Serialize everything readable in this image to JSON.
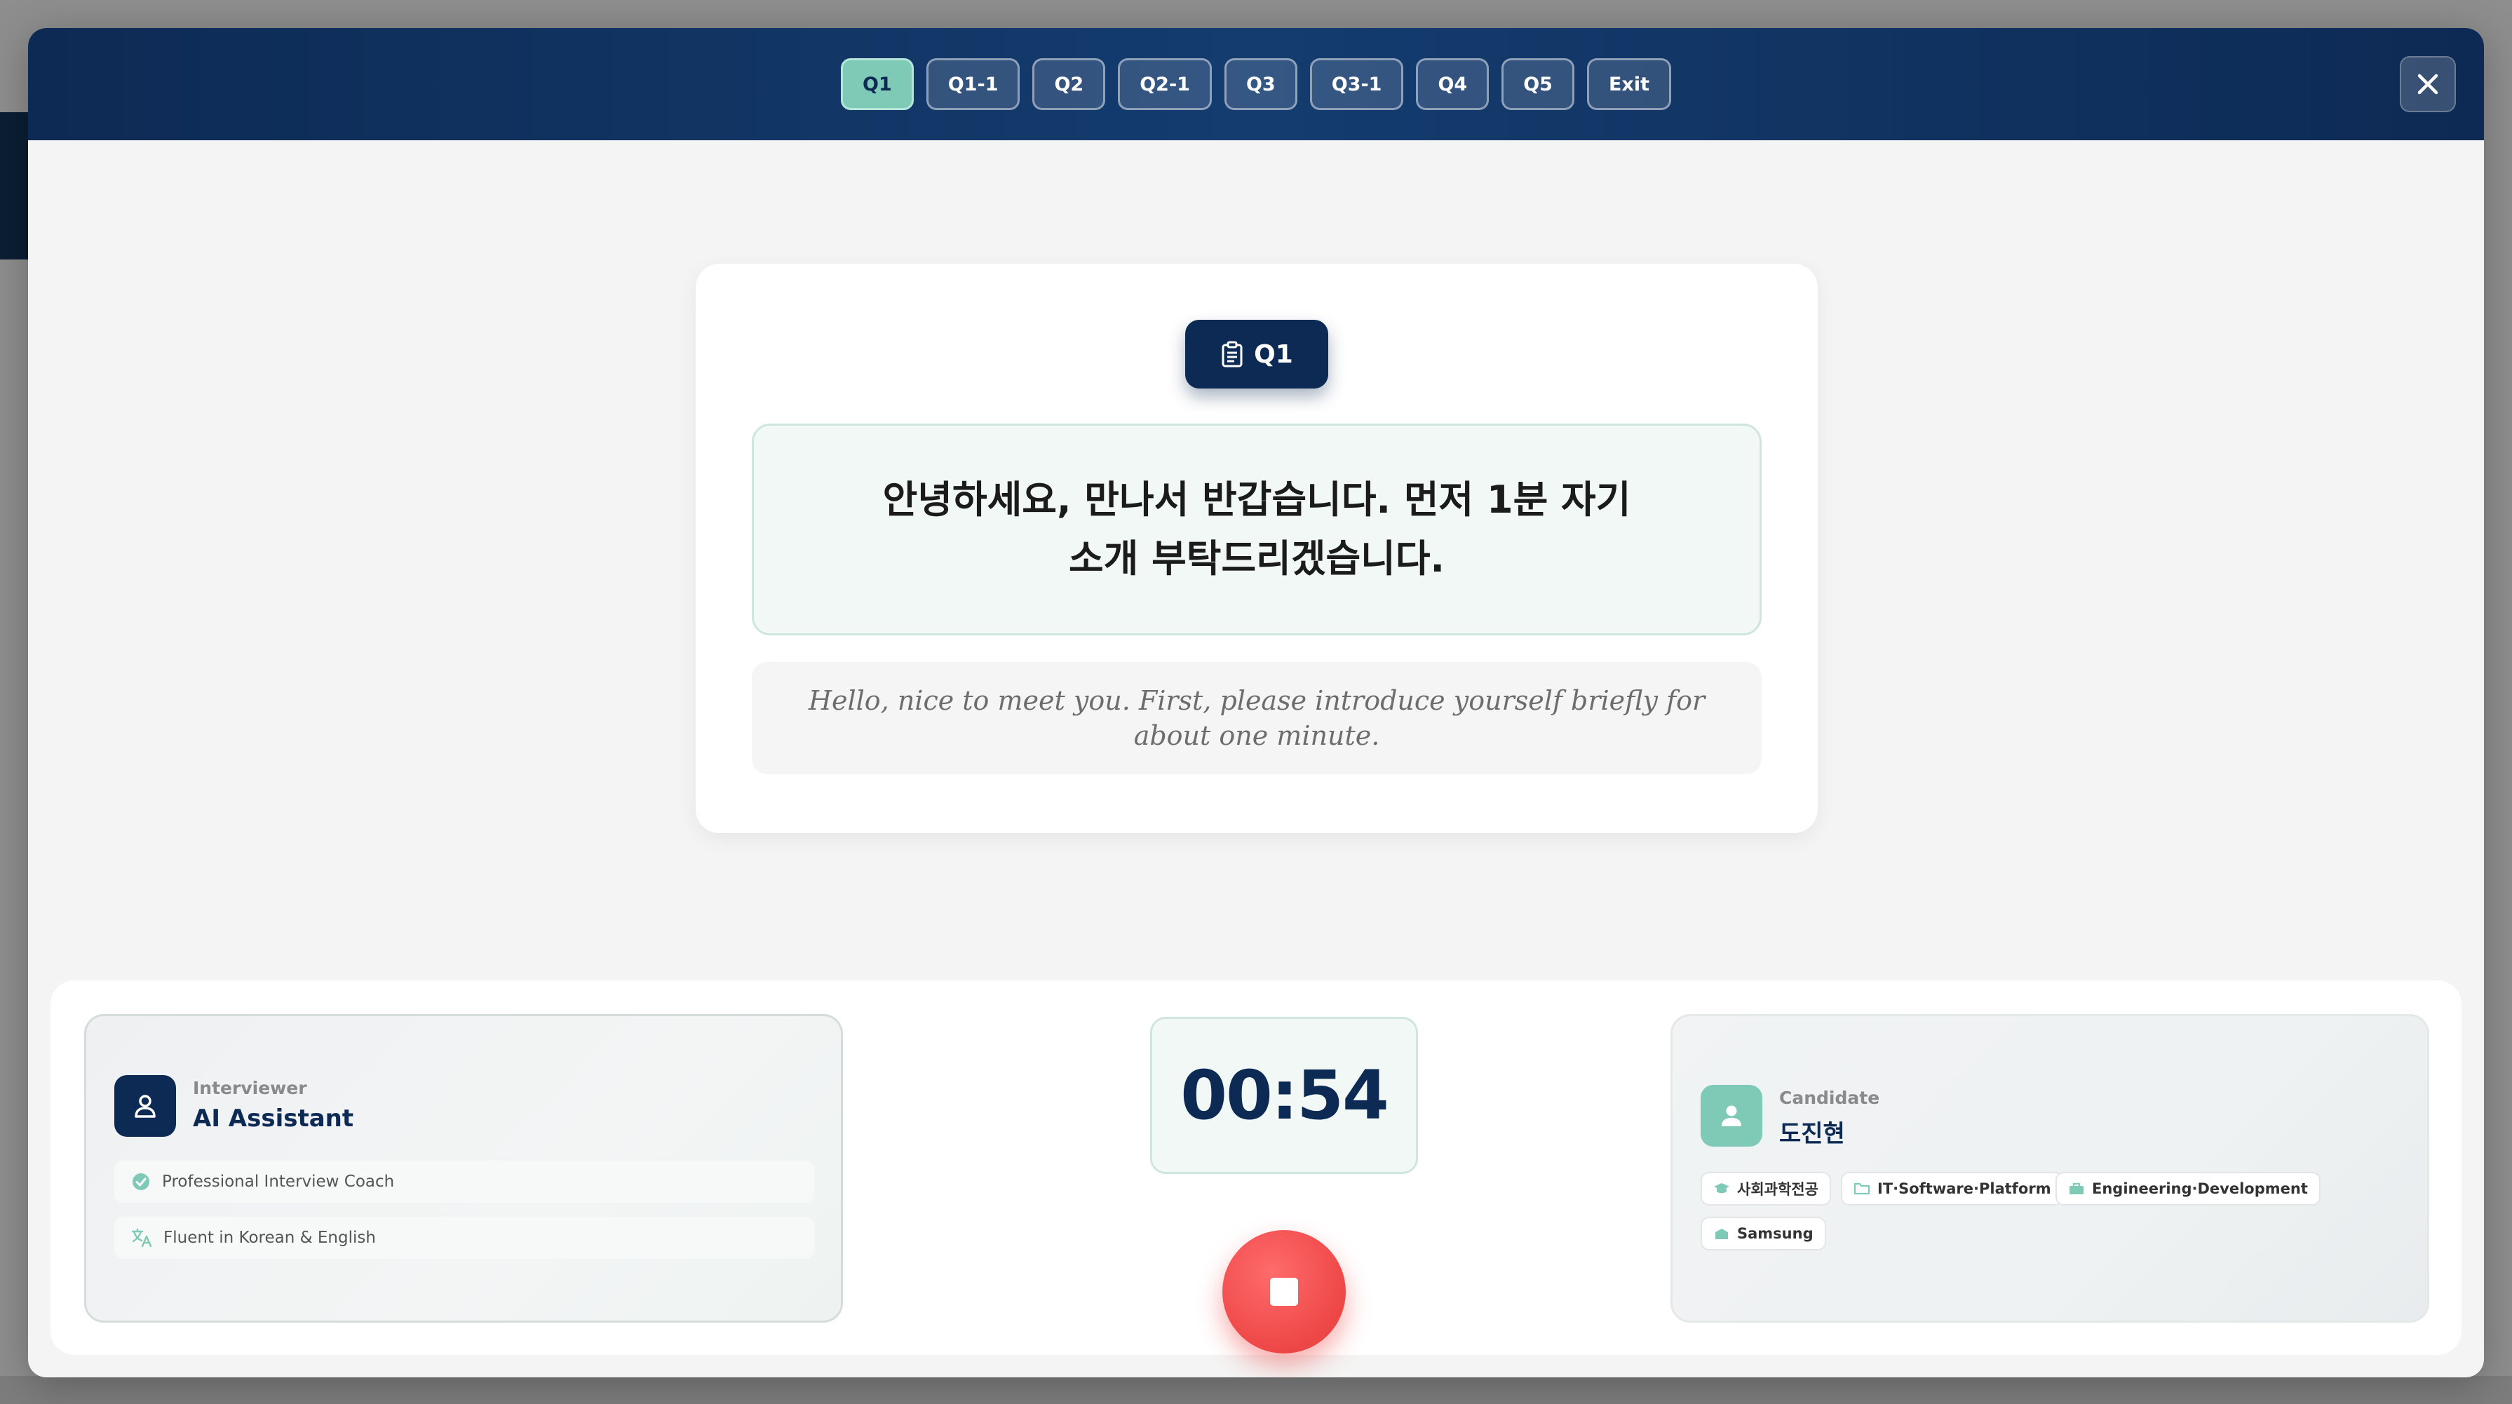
{
  "topbar": {
    "tabs": [
      {
        "label": "Q1",
        "active": true
      },
      {
        "label": "Q1-1",
        "active": false
      },
      {
        "label": "Q2",
        "active": false
      },
      {
        "label": "Q2-1",
        "active": false
      },
      {
        "label": "Q3",
        "active": false
      },
      {
        "label": "Q3-1",
        "active": false
      },
      {
        "label": "Q4",
        "active": false
      },
      {
        "label": "Q5",
        "active": false
      },
      {
        "label": "Exit",
        "active": false
      }
    ],
    "close_icon": "close-icon"
  },
  "question": {
    "badge_label": "Q1",
    "badge_icon": "clipboard-icon",
    "korean": "안녕하세요, 만나서 반갑습니다. 먼저 1분 자기소개 부탁드리겠습니다.",
    "english": "Hello, nice to meet you. First, please introduce yourself briefly for about one minute."
  },
  "interviewer": {
    "role": "Interviewer",
    "name": "AI Assistant",
    "features": [
      {
        "icon": "check-badge-icon",
        "label": "Professional Interview Coach"
      },
      {
        "icon": "translate-icon",
        "label": "Fluent in Korean & English"
      }
    ]
  },
  "timer": {
    "value": "00:54"
  },
  "candidate": {
    "role": "Candidate",
    "name": "도진현",
    "tags": [
      {
        "icon": "graduation-cap-icon",
        "label": "사회과학전공"
      },
      {
        "icon": "folder-icon",
        "label": "IT·Software·Platform"
      },
      {
        "icon": "briefcase-icon",
        "label": "Engineering·Development"
      },
      {
        "icon": "building-icon",
        "label": "Samsung"
      }
    ]
  },
  "colors": {
    "navy": "#0d2a54",
    "mint": "#7ecab7",
    "stop_red": "#ee4747"
  }
}
